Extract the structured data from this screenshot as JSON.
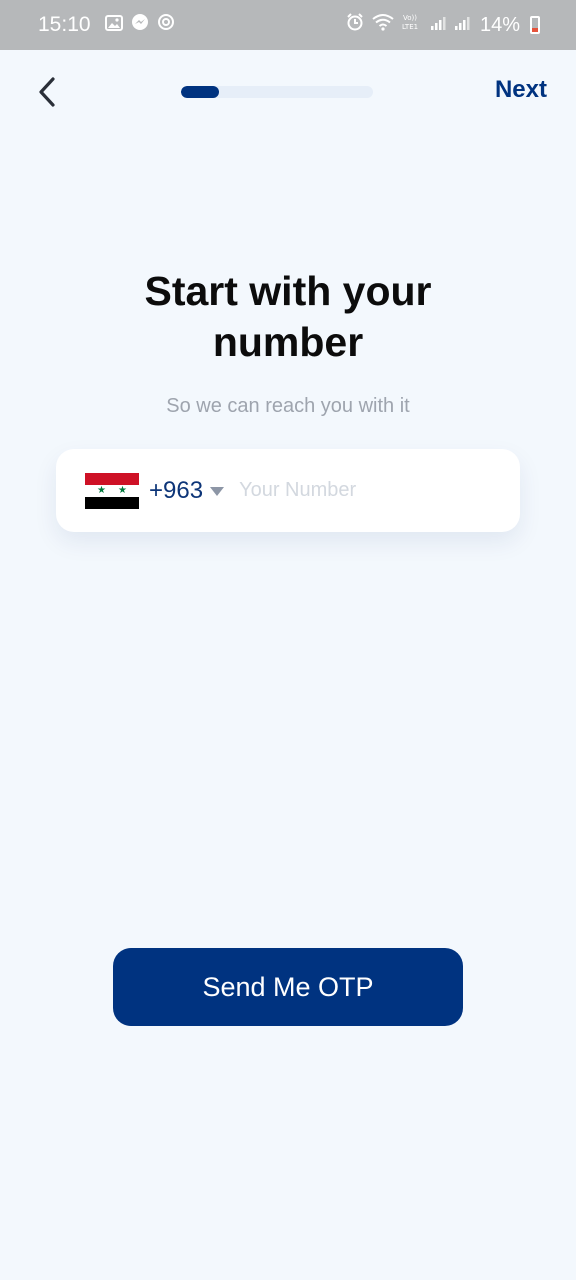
{
  "status_bar": {
    "time": "15:10",
    "battery": "14%",
    "icons_left": [
      "gallery-icon",
      "messenger-icon",
      "sync-icon"
    ],
    "icons_right": [
      "alarm-icon",
      "wifi-icon",
      "volte-icon",
      "signal-icon",
      "signal-icon",
      "battery-icon"
    ],
    "volte_text": "Vo)) LTE1"
  },
  "topbar": {
    "next_label": "Next",
    "progress_fraction": 0.2
  },
  "main": {
    "title_line1": "Start with your",
    "title_line2": "number",
    "subtitle": "So we can reach you with it"
  },
  "phone": {
    "country_code": "+963",
    "flag": "syria-flag",
    "number_value": "",
    "number_placeholder": "Your Number"
  },
  "actions": {
    "send_otp_label": "Send Me OTP"
  },
  "colors": {
    "primary": "#003380",
    "background": "#f3f8fd",
    "muted": "#9ea4ae"
  }
}
